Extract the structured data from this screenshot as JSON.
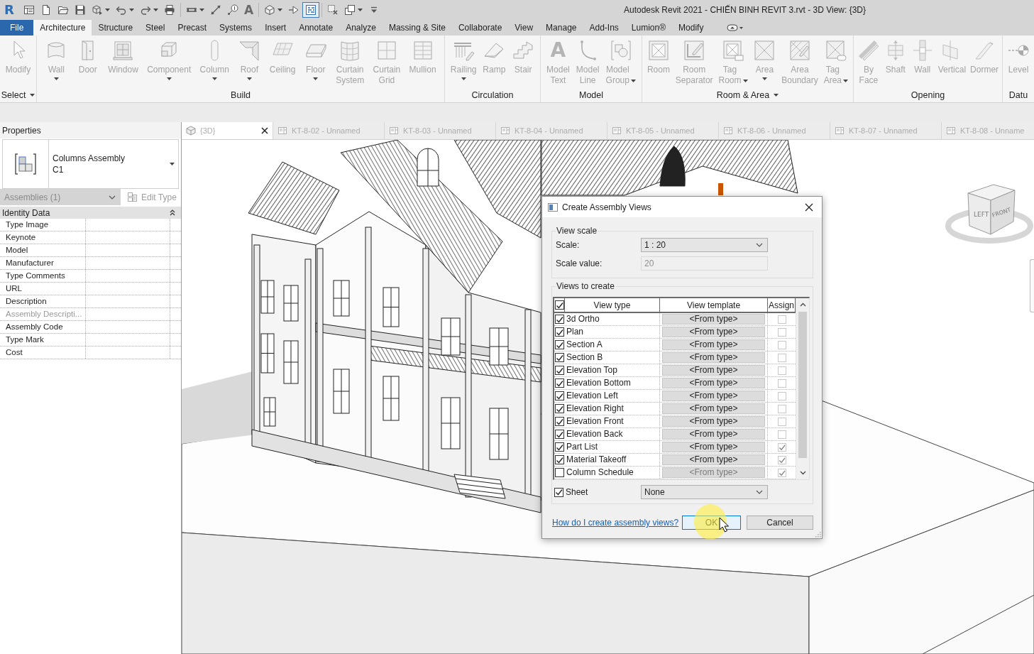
{
  "window": {
    "title": "Autodesk Revit 2021 - CHIẾN BINH REVIT 3.rvt - 3D View: {3D}"
  },
  "quick_access": {
    "logo": "R",
    "groups": [
      [
        {
          "dropdown": false,
          "on": false
        },
        {
          "dropdown": false,
          "on": false
        },
        {
          "dropdown": false,
          "on": false
        },
        {
          "dropdown": false,
          "on": false
        },
        {
          "dropdown": true,
          "on": false
        },
        {
          "dropdown": true,
          "on": false
        },
        {
          "dropdown": true,
          "on": false
        },
        {
          "dropdown": false,
          "on": false
        }
      ],
      [
        {
          "dropdown": true,
          "on": false
        },
        {
          "dropdown": false,
          "on": false
        },
        {
          "dropdown": false,
          "on": false
        },
        {
          "dropdown": false,
          "on": false,
          "glyph": "A"
        }
      ],
      [
        {
          "dropdown": true,
          "on": false
        },
        {
          "dropdown": false,
          "on": false
        },
        {
          "dropdown": false,
          "on": true
        }
      ],
      [
        {
          "dropdown": false,
          "on": false
        },
        {
          "dropdown": true,
          "on": false
        },
        {
          "dropdown": false,
          "on": false
        }
      ]
    ]
  },
  "ribbon": {
    "tabs": [
      {
        "label": "File",
        "kind": "file",
        "selected": false
      },
      {
        "label": "Architecture",
        "kind": "tab",
        "selected": true
      },
      {
        "label": "Structure",
        "kind": "tab",
        "selected": false
      },
      {
        "label": "Steel",
        "kind": "tab",
        "selected": false
      },
      {
        "label": "Precast",
        "kind": "tab",
        "selected": false
      },
      {
        "label": "Systems",
        "kind": "tab",
        "selected": false
      },
      {
        "label": "Insert",
        "kind": "tab",
        "selected": false
      },
      {
        "label": "Annotate",
        "kind": "tab",
        "selected": false
      },
      {
        "label": "Analyze",
        "kind": "tab",
        "selected": false
      },
      {
        "label": "Massing & Site",
        "kind": "tab",
        "selected": false
      },
      {
        "label": "Collaborate",
        "kind": "tab",
        "selected": false
      },
      {
        "label": "View",
        "kind": "tab",
        "selected": false
      },
      {
        "label": "Manage",
        "kind": "tab",
        "selected": false
      },
      {
        "label": "Add-Ins",
        "kind": "tab",
        "selected": false
      },
      {
        "label": "Lumion®",
        "kind": "tab",
        "selected": false
      },
      {
        "label": "Modify",
        "kind": "tab",
        "selected": false
      }
    ],
    "panels": [
      {
        "title": "Select",
        "menu": true,
        "buttons": [
          {
            "label": "Modify",
            "dropdown": false,
            "disabled": true
          }
        ]
      },
      {
        "title": "Build",
        "menu": false,
        "buttons": [
          {
            "label": "Wall",
            "dropdown": true,
            "disabled": true
          },
          {
            "label": "Door",
            "dropdown": false,
            "disabled": true
          },
          {
            "label": "Window",
            "dropdown": false,
            "disabled": true
          },
          {
            "label": "Component",
            "dropdown": true,
            "disabled": true
          },
          {
            "label": "Column",
            "dropdown": true,
            "disabled": true
          },
          {
            "label": "Roof",
            "dropdown": true,
            "disabled": true
          },
          {
            "label": "Ceiling",
            "dropdown": false,
            "disabled": true
          },
          {
            "label": "Floor",
            "dropdown": true,
            "disabled": true
          },
          {
            "label": "Curtain\nSystem",
            "dropdown": false,
            "disabled": true
          },
          {
            "label": "Curtain\nGrid",
            "dropdown": false,
            "disabled": true
          },
          {
            "label": "Mullion",
            "dropdown": false,
            "disabled": true
          }
        ]
      },
      {
        "title": "Circulation",
        "menu": false,
        "buttons": [
          {
            "label": "Railing",
            "dropdown": true,
            "disabled": true
          },
          {
            "label": "Ramp",
            "dropdown": false,
            "disabled": true
          },
          {
            "label": "Stair",
            "dropdown": false,
            "disabled": true
          }
        ]
      },
      {
        "title": "Model",
        "menu": false,
        "buttons": [
          {
            "label": "Model\nText",
            "dropdown": false,
            "disabled": true,
            "glyph": "A"
          },
          {
            "label": "Model\nLine",
            "dropdown": false,
            "disabled": true
          },
          {
            "label": "Model\nGroup",
            "dropdown": true,
            "disabled": true
          }
        ]
      },
      {
        "title": "Room & Area",
        "menu": true,
        "buttons": [
          {
            "label": "Room",
            "dropdown": false,
            "disabled": true
          },
          {
            "label": "Room\nSeparator",
            "dropdown": false,
            "disabled": true
          },
          {
            "label": "Tag\nRoom",
            "dropdown": true,
            "disabled": true
          },
          {
            "label": "Area",
            "dropdown": true,
            "disabled": true
          },
          {
            "label": "Area\nBoundary",
            "dropdown": false,
            "disabled": true
          },
          {
            "label": "Tag\nArea",
            "dropdown": true,
            "disabled": true
          }
        ]
      },
      {
        "title": "Opening",
        "menu": false,
        "buttons": [
          {
            "label": "By\nFace",
            "dropdown": false,
            "disabled": true
          },
          {
            "label": "Shaft",
            "dropdown": false,
            "disabled": true
          },
          {
            "label": "Wall",
            "dropdown": false,
            "disabled": true
          },
          {
            "label": "Vertical",
            "dropdown": false,
            "disabled": true
          },
          {
            "label": "Dormer",
            "dropdown": false,
            "disabled": true
          }
        ]
      },
      {
        "title": "Datu",
        "menu": false,
        "buttons": [
          {
            "label": "Level",
            "dropdown": false,
            "disabled": true
          }
        ]
      }
    ]
  },
  "properties": {
    "title": "Properties",
    "type": {
      "name": "Columns Assembly",
      "subtype": "C1"
    },
    "filter": {
      "value": "Assemblies (1)",
      "disabled": true
    },
    "edit_type": {
      "label": "Edit Type",
      "disabled": true
    },
    "groups": [
      {
        "title": "Identity Data",
        "expanded": true,
        "rows": [
          {
            "name": "Type Image",
            "disabled": false
          },
          {
            "name": "Keynote",
            "disabled": false
          },
          {
            "name": "Model",
            "disabled": false
          },
          {
            "name": "Manufacturer",
            "disabled": false
          },
          {
            "name": "Type Comments",
            "disabled": false
          },
          {
            "name": "URL",
            "disabled": false
          },
          {
            "name": "Description",
            "disabled": false
          },
          {
            "name": "Assembly Descripti...",
            "disabled": true
          },
          {
            "name": "Assembly Code",
            "disabled": false
          },
          {
            "name": "Type Mark",
            "disabled": false
          },
          {
            "name": "Cost",
            "disabled": false
          }
        ]
      }
    ]
  },
  "view_tabs": [
    {
      "label": "{3D}",
      "kind": "model",
      "selected": true
    },
    {
      "label": "KT-8-02 - Unnamed",
      "kind": "sheet",
      "selected": false
    },
    {
      "label": "KT-8-03 - Unnamed",
      "kind": "sheet",
      "selected": false
    },
    {
      "label": "KT-8-04 - Unnamed",
      "kind": "sheet",
      "selected": false
    },
    {
      "label": "KT-8-05 - Unnamed",
      "kind": "sheet",
      "selected": false
    },
    {
      "label": "KT-8-06 - Unnamed",
      "kind": "sheet",
      "selected": false
    },
    {
      "label": "KT-8-07 - Unnamed",
      "kind": "sheet",
      "selected": false
    },
    {
      "label": "KT-8-08 - Unname",
      "kind": "sheet",
      "selected": false
    }
  ],
  "view_cube": {
    "left": "LEFT",
    "front": "FRONT"
  },
  "dialog": {
    "title": "Create Assembly Views",
    "view_scale": {
      "legend": "View scale",
      "scale_label": "Scale:",
      "scale": "1 : 20",
      "value_label": "Scale value:",
      "value": "20",
      "value_disabled": true
    },
    "views": {
      "legend": "Views to create",
      "all_checked": true,
      "columns": [
        "View type",
        "View template",
        "Assign"
      ],
      "rows": [
        {
          "name": "3d Ortho",
          "checked": true,
          "template": "<From type>",
          "assign": false
        },
        {
          "name": "Plan",
          "checked": true,
          "template": "<From type>",
          "assign": false
        },
        {
          "name": "Section A",
          "checked": true,
          "template": "<From type>",
          "assign": false
        },
        {
          "name": "Section B",
          "checked": true,
          "template": "<From type>",
          "assign": false
        },
        {
          "name": "Elevation Top",
          "checked": true,
          "template": "<From type>",
          "assign": false
        },
        {
          "name": "Elevation Bottom",
          "checked": true,
          "template": "<From type>",
          "assign": false
        },
        {
          "name": "Elevation Left",
          "checked": true,
          "template": "<From type>",
          "assign": false
        },
        {
          "name": "Elevation Right",
          "checked": true,
          "template": "<From type>",
          "assign": false
        },
        {
          "name": "Elevation Front",
          "checked": true,
          "template": "<From type>",
          "assign": false
        },
        {
          "name": "Elevation Back",
          "checked": true,
          "template": "<From type>",
          "assign": false
        },
        {
          "name": "Part List",
          "checked": true,
          "template": "<From type>",
          "assign": true
        },
        {
          "name": "Material Takeoff",
          "checked": true,
          "template": "<From type>",
          "assign": true
        },
        {
          "name": "Column Schedule",
          "checked": false,
          "template": "<From type>",
          "assign": true
        }
      ]
    },
    "sheet": {
      "label": "Sheet",
      "checked": true,
      "value": "None"
    },
    "help_link": "How do I create assembly views?",
    "buttons": [
      {
        "label": "OK",
        "focused": true
      },
      {
        "label": "Cancel",
        "focused": false
      }
    ]
  }
}
